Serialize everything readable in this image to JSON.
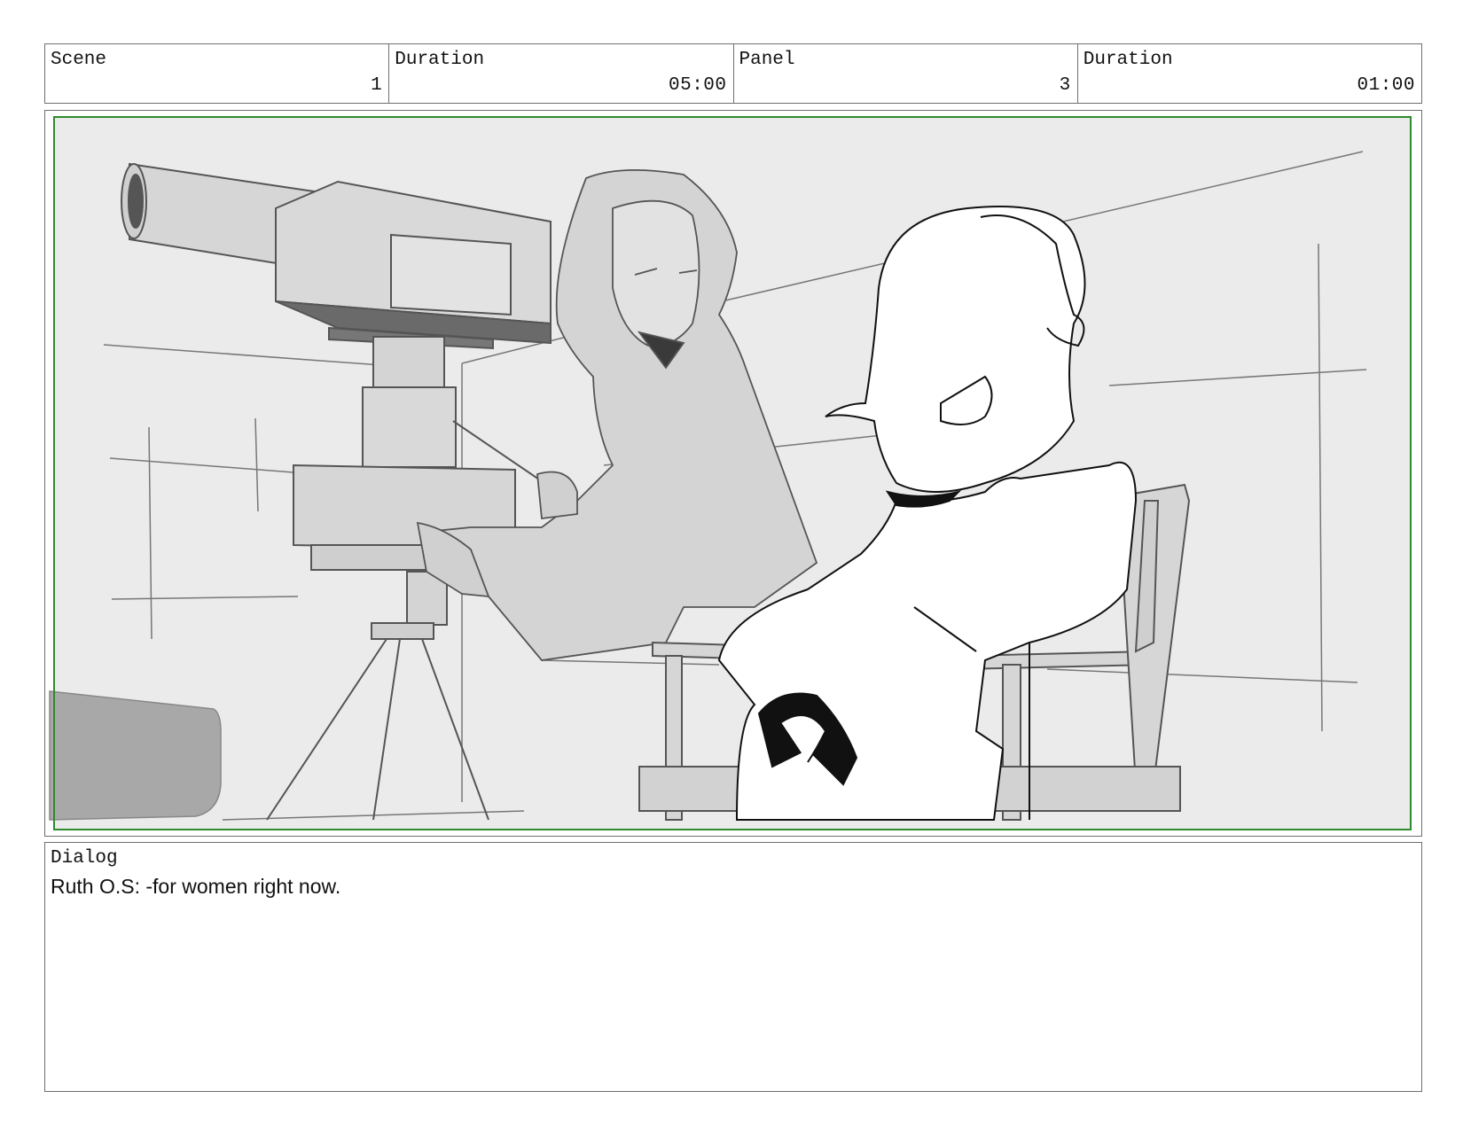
{
  "header": {
    "cells": [
      {
        "label": "Scene",
        "value": "1"
      },
      {
        "label": "Duration",
        "value": "05:00"
      },
      {
        "label": "Panel",
        "value": "3"
      },
      {
        "label": "Duration",
        "value": "01:00"
      }
    ]
  },
  "panel": {
    "frame_color": "#2e8b2e",
    "background_color": "#ebebeb"
  },
  "dialog": {
    "label": "Dialog",
    "text": "Ruth O.S:  -for women right now."
  }
}
